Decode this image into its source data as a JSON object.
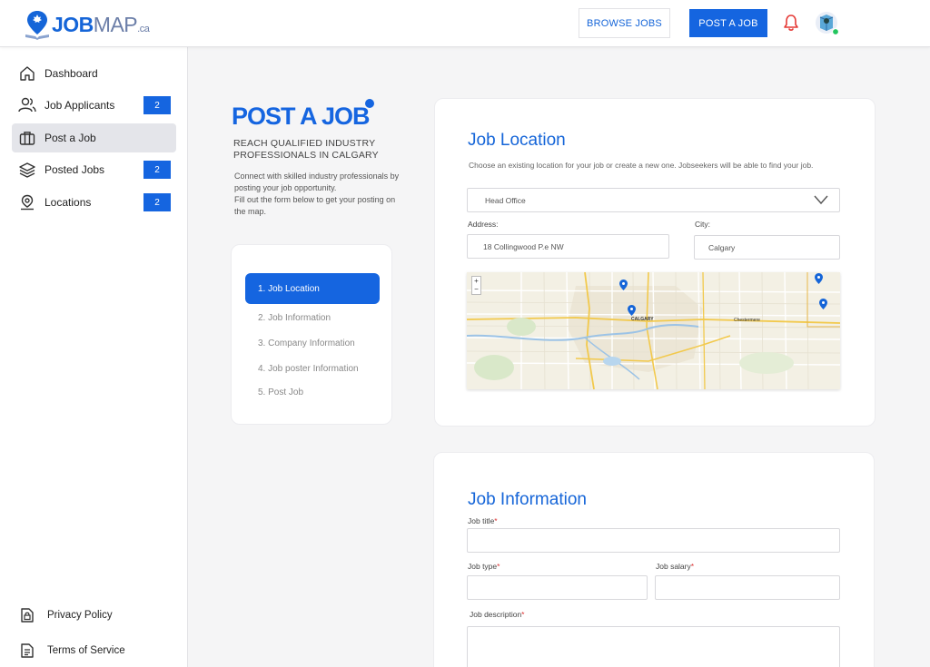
{
  "header": {
    "logo": {
      "brand_bold": "JOB",
      "brand_light": "MAP",
      "brand_suffix": ".ca"
    },
    "browse_jobs_label": "BROWSE JOBS",
    "post_job_label": "POST A JOB",
    "colors": {
      "primary": "#1565e0",
      "bell": "#e53935",
      "online": "#22c55e"
    }
  },
  "sidebar": {
    "items": [
      {
        "label": "Dashboard",
        "icon": "home-icon"
      },
      {
        "label": "Job Applicants",
        "icon": "users-icon",
        "badge": "2"
      },
      {
        "label": "Post a Job",
        "icon": "briefcase-icon",
        "active": true
      },
      {
        "label": "Posted Jobs",
        "icon": "layers-icon",
        "badge": "2"
      },
      {
        "label": "Locations",
        "icon": "location-pin-icon",
        "badge": "2"
      }
    ],
    "footer": [
      {
        "label": "Privacy Policy",
        "icon": "lock-file-icon"
      },
      {
        "label": "Terms of Service",
        "icon": "document-icon"
      }
    ]
  },
  "intro": {
    "title": "POST A JOB",
    "subtitle": "REACH QUALIFIED INDUSTRY PROFESSIONALS IN CALGARY",
    "description_1": "Connect with skilled industry professionals by posting your job opportunity.",
    "description_2": "Fill out the form below to get your posting on the map."
  },
  "steps": [
    {
      "label": "1. Job Location",
      "active": true
    },
    {
      "label": "2. Job Information"
    },
    {
      "label": "3. Company Information"
    },
    {
      "label": "4. Job poster Information"
    },
    {
      "label": "5. Post Job"
    }
  ],
  "job_location": {
    "title": "Job Location",
    "description": "Choose an existing location for your job or create a new one. Jobseekers will be able to find your job.",
    "selected_location": "Head Office",
    "address_label": "Address:",
    "address_value": "18 Collingwood P.e NW",
    "city_label": "City:",
    "city_value": "Calgary",
    "map": {
      "zoom_in": "+",
      "zoom_out": "−",
      "city_label": "CALGARY",
      "town_label": "Chestermere"
    }
  },
  "job_information": {
    "title": "Job Information",
    "job_title_label": "Job title",
    "job_type_label": "Job type",
    "job_salary_label": "Job salary",
    "job_description_label": "Job description",
    "required_mark": "*"
  }
}
